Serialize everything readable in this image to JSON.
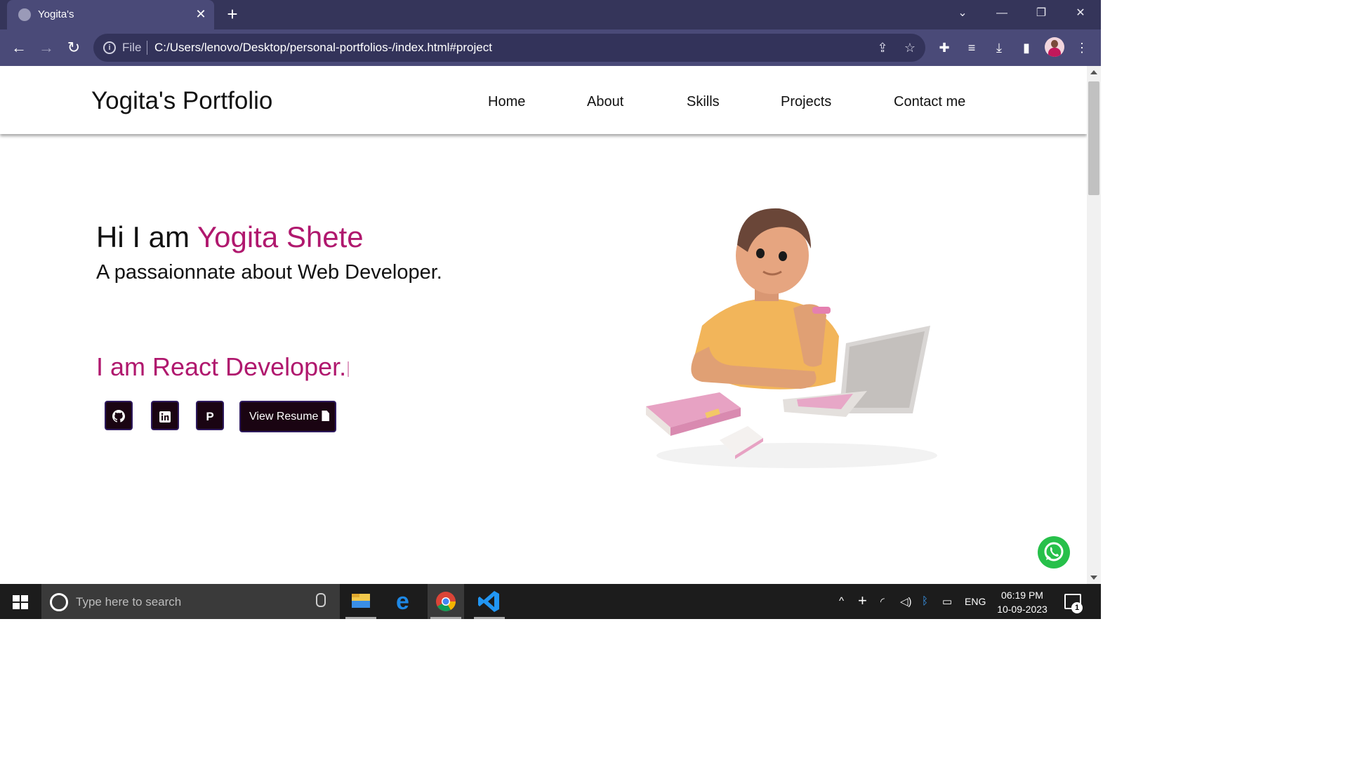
{
  "browser": {
    "tab_title": "Yogita's",
    "tab_close": "✕",
    "new_tab": "+",
    "address_prefix": "File",
    "url": "C:/Users/lenovo/Desktop/personal-portfolios-/index.html#project",
    "window_controls": [
      "⌄",
      "—",
      "❐",
      "✕"
    ]
  },
  "site": {
    "brand": "Yogita's Portfolio",
    "nav": [
      "Home",
      "About",
      "Skills",
      "Projects",
      "Contact me"
    ],
    "hero": {
      "greeting": "Hi I am ",
      "name": "Yogita Shete",
      "tagline": "A passaionnate about Web Developer.",
      "typed_text": "I am React Developer."
    },
    "social_buttons": [
      {
        "icon": "github-icon",
        "glyph": "⌾"
      },
      {
        "icon": "linkedin-icon",
        "glyph": "in"
      },
      {
        "icon": "p-letter-icon",
        "glyph": "P"
      }
    ],
    "resume_button": "View Resume",
    "accent_color": "#b0186e",
    "button_color": "#1a0412"
  },
  "taskbar": {
    "search_placeholder": "Type here to search",
    "language": "ENG",
    "time": "06:19 PM",
    "date": "10-09-2023",
    "notification_count": "1"
  }
}
